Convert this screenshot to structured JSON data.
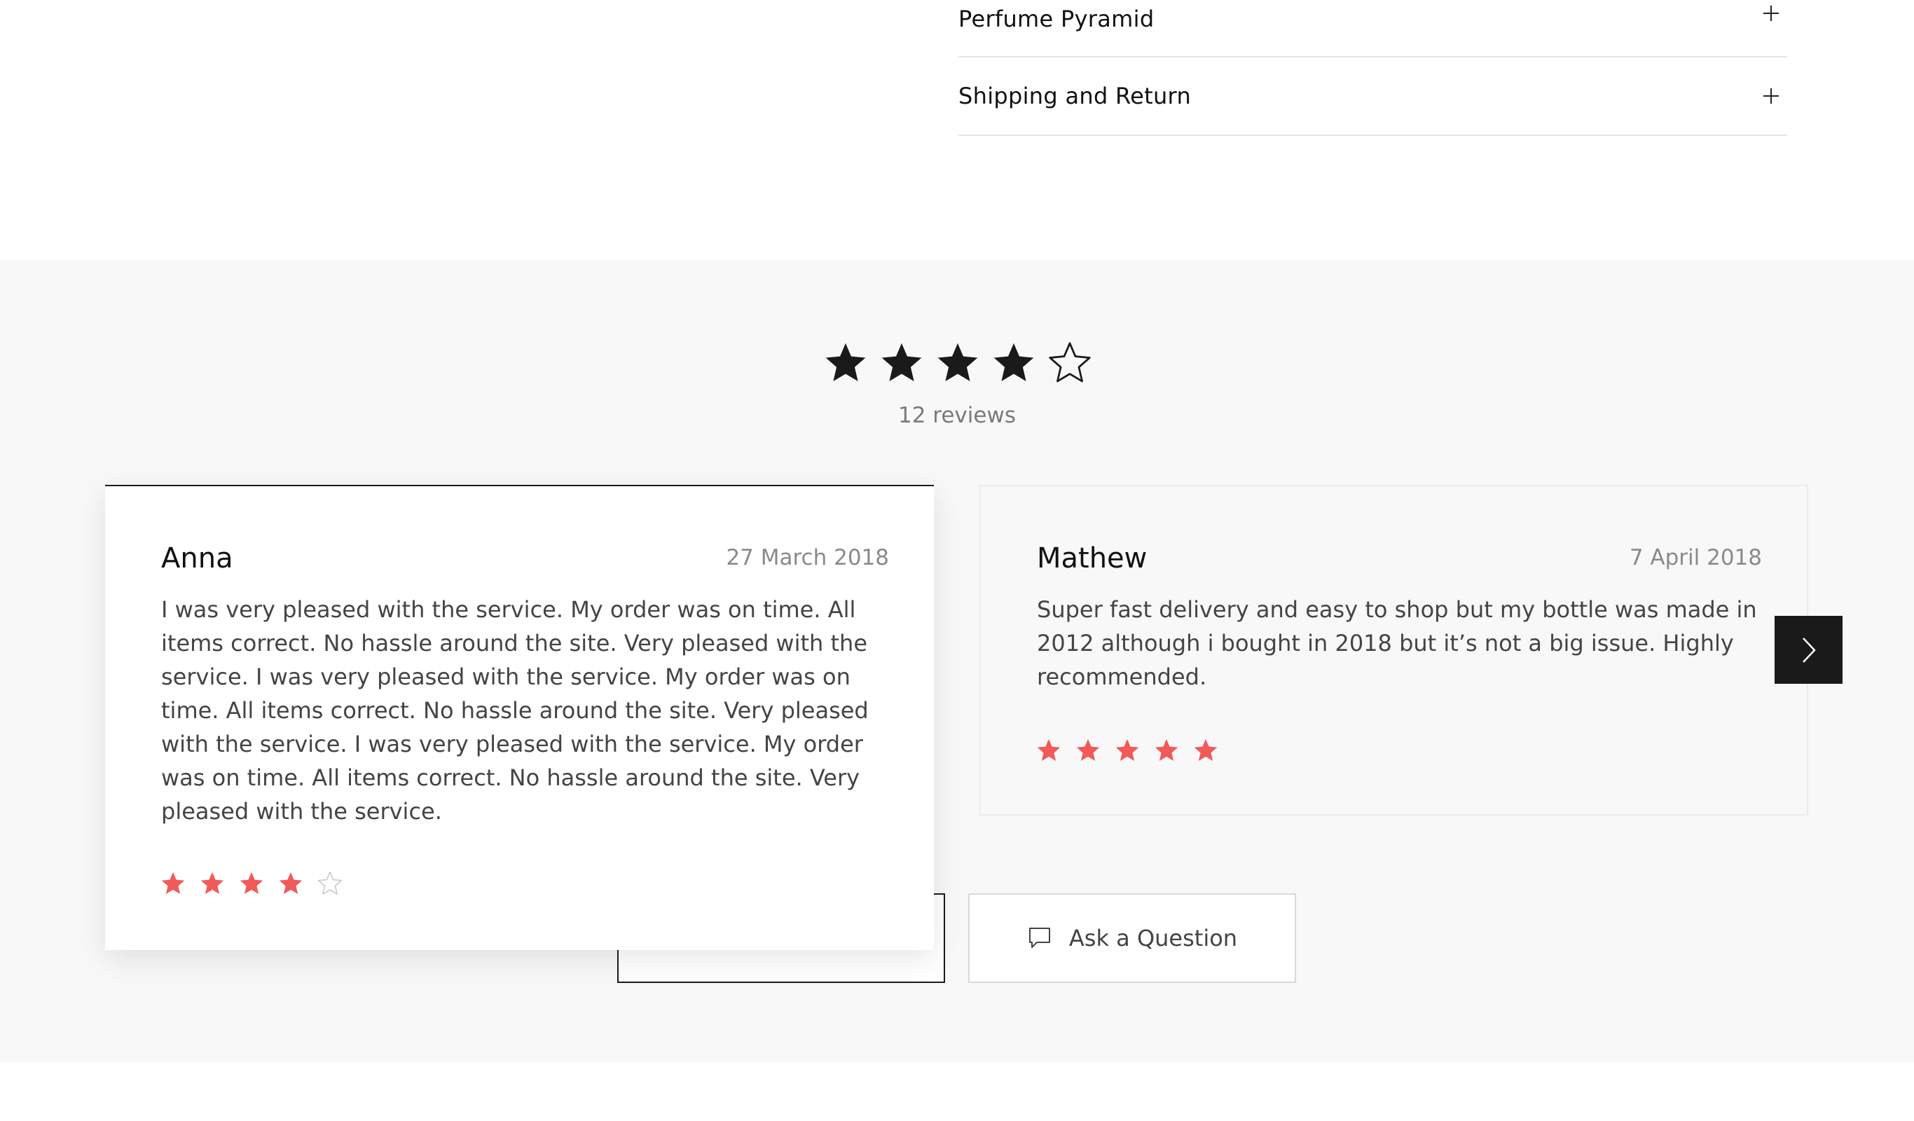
{
  "accordion": {
    "items": [
      {
        "label": "Perfume Pyramid",
        "icon": "plus-icon"
      },
      {
        "label": "Shipping and Return",
        "icon": "plus-icon"
      }
    ]
  },
  "reviews": {
    "average_rating": 4,
    "max_rating": 5,
    "count_label": "12 reviews",
    "cards": [
      {
        "name": "Anna",
        "date": "27 March 2018",
        "text": "I was very pleased with the service. My order was on time. All items correct. No hassle around the site. Very pleased with the service. I was very pleased with the service. My order was on time. All items correct. No hassle around the site. Very pleased with the service. I was very pleased with the service. My order was on time. All items correct. No hassle around the site. Very pleased with the service.",
        "rating": 4
      },
      {
        "name": "Mathew",
        "date": "7 April 2018",
        "text": "Super fast delivery and easy to shop but my bottle was made in 2012 although i bought in 2018 but it’s not a big issue. Highly recommended.",
        "rating": 5
      }
    ],
    "next_icon": "chevron-right-icon",
    "write_button_label": "",
    "ask_button": {
      "label": "Ask a Question",
      "icon": "speech-bubble-icon"
    }
  },
  "colors": {
    "star_dark": "#1a1a1a",
    "star_accent": "#f25a5a",
    "section_background": "#f8f8f8",
    "arrow_background": "#1a1a1a"
  }
}
